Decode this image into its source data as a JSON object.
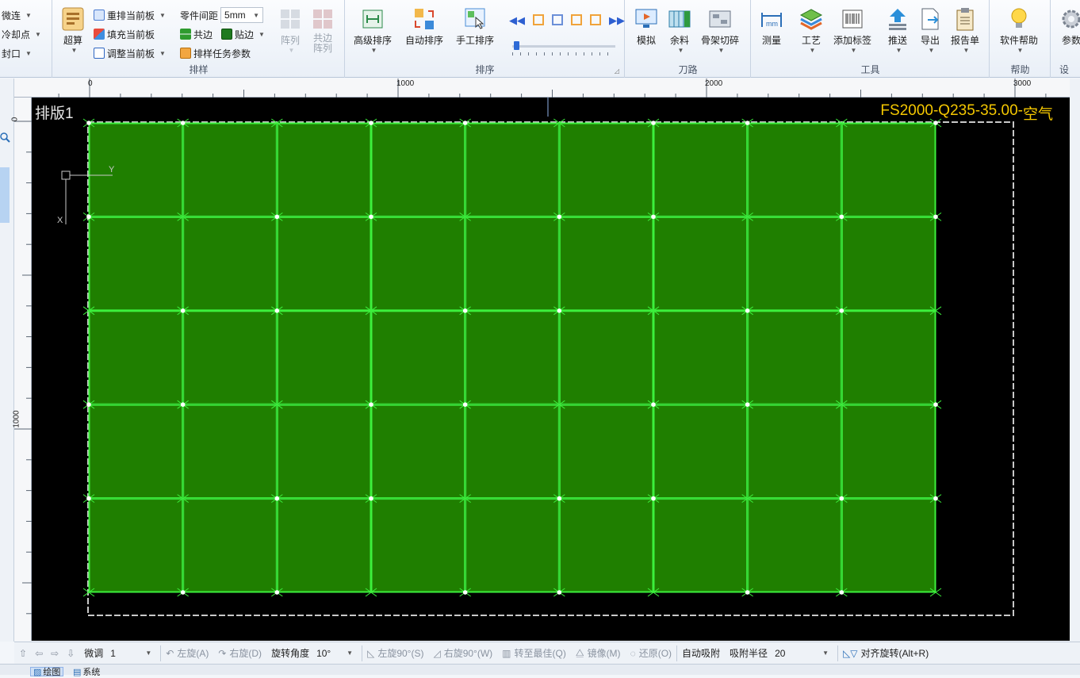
{
  "ribbon": {
    "group1": {
      "items": [
        "微连",
        "冷却点",
        "封口"
      ]
    },
    "nesting": {
      "title": "排样",
      "super_calc": "超算",
      "renest_label": "重排当前板",
      "fill_label": "填充当前板",
      "adjust_label": "调整当前板",
      "spacing_label": "零件间距",
      "spacing_value": "5mm",
      "common_edge_label": "共边",
      "stick_edge_label": "贴边",
      "task_params_label": "排样任务参数",
      "array_label": "阵列",
      "common_array_label": "共边阵列"
    },
    "sorting": {
      "title": "排序",
      "advanced": "高级排序",
      "auto": "自动排序",
      "manual": "手工排序",
      "slider_position": 0.02
    },
    "toolpath": {
      "title": "刀路",
      "simulate": "模拟",
      "remnant": "余料",
      "skeleton": "骨架切碎"
    },
    "tools": {
      "title": "工具",
      "measure": "测量",
      "process": "工艺",
      "add_label": "添加标签",
      "push": "推送",
      "export": "导出",
      "report": "报告单"
    },
    "help": {
      "title": "帮助",
      "software_help": "软件帮助"
    },
    "settings": {
      "title": "设",
      "params": "参数"
    }
  },
  "ruler": {
    "top_labels": [
      "0",
      "1000",
      "2000",
      "3000"
    ],
    "left_labels": [
      "0",
      "1000"
    ]
  },
  "canvas": {
    "sheet_name": "排版1",
    "material_code": "FS2000-Q235-35.00-",
    "material_gas": "空气",
    "axis_x": "X",
    "axis_y": "Y",
    "grid_cols": 9,
    "grid_rows": 5,
    "colors": {
      "part_fill": "#1f7f00",
      "part_edge": "#3cf03c",
      "material_code": "#f5c800"
    }
  },
  "statusbar": {
    "fine_tune_label": "微调",
    "fine_tune_value": "1",
    "rotate_left": "左旋(A)",
    "rotate_right": "右旋(D)",
    "rotate_angle_label": "旋转角度",
    "rotate_angle_value": "10°",
    "rotate_left_90": "左旋90°(S)",
    "rotate_right_90": "右旋90°(W)",
    "rotate_best": "转至最佳(Q)",
    "mirror": "镜像(M)",
    "restore": "还原(O)",
    "auto_snap": "自动吸附",
    "snap_radius_label": "吸附半径",
    "snap_radius_value": "20",
    "align_rotate": "对齐旋转(Alt+R)"
  },
  "tabs": [
    "绘图",
    "系统"
  ]
}
